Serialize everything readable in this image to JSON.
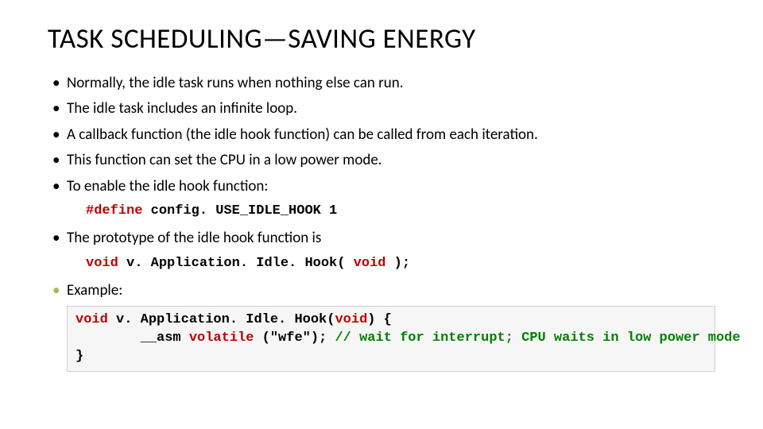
{
  "title": "TASK SCHEDULING—SAVING ENERGY",
  "bullets": {
    "b1": "Normally, the idle task runs when nothing else can run.",
    "b2": "The idle task includes an infinite loop.",
    "b3": "A callback function (the idle hook function) can be called from each iteration.",
    "b4": "This function can set the CPU in a low power mode.",
    "b5": "To enable the idle hook function:",
    "b6": "The prototype of the idle hook function is",
    "b7": "Example:"
  },
  "code": {
    "define_pre": "#define",
    "define_rest": " config. USE_IDLE_HOOK     1",
    "proto_kw1": "void",
    "proto_mid": " v. Application. Idle. Hook( ",
    "proto_kw2": "void",
    "proto_end": " );",
    "ex_kw1": "void",
    "ex_sig1": " v. Application. Idle. Hook(",
    "ex_kw2": "void",
    "ex_sig2": ") {",
    "ex_l2a": "        __asm ",
    "ex_kw3": "volatile",
    "ex_l2b": " (\"wfe\"); ",
    "ex_cm": "// wait for interrupt; CPU waits in low power mode",
    "ex_l3": "}"
  }
}
